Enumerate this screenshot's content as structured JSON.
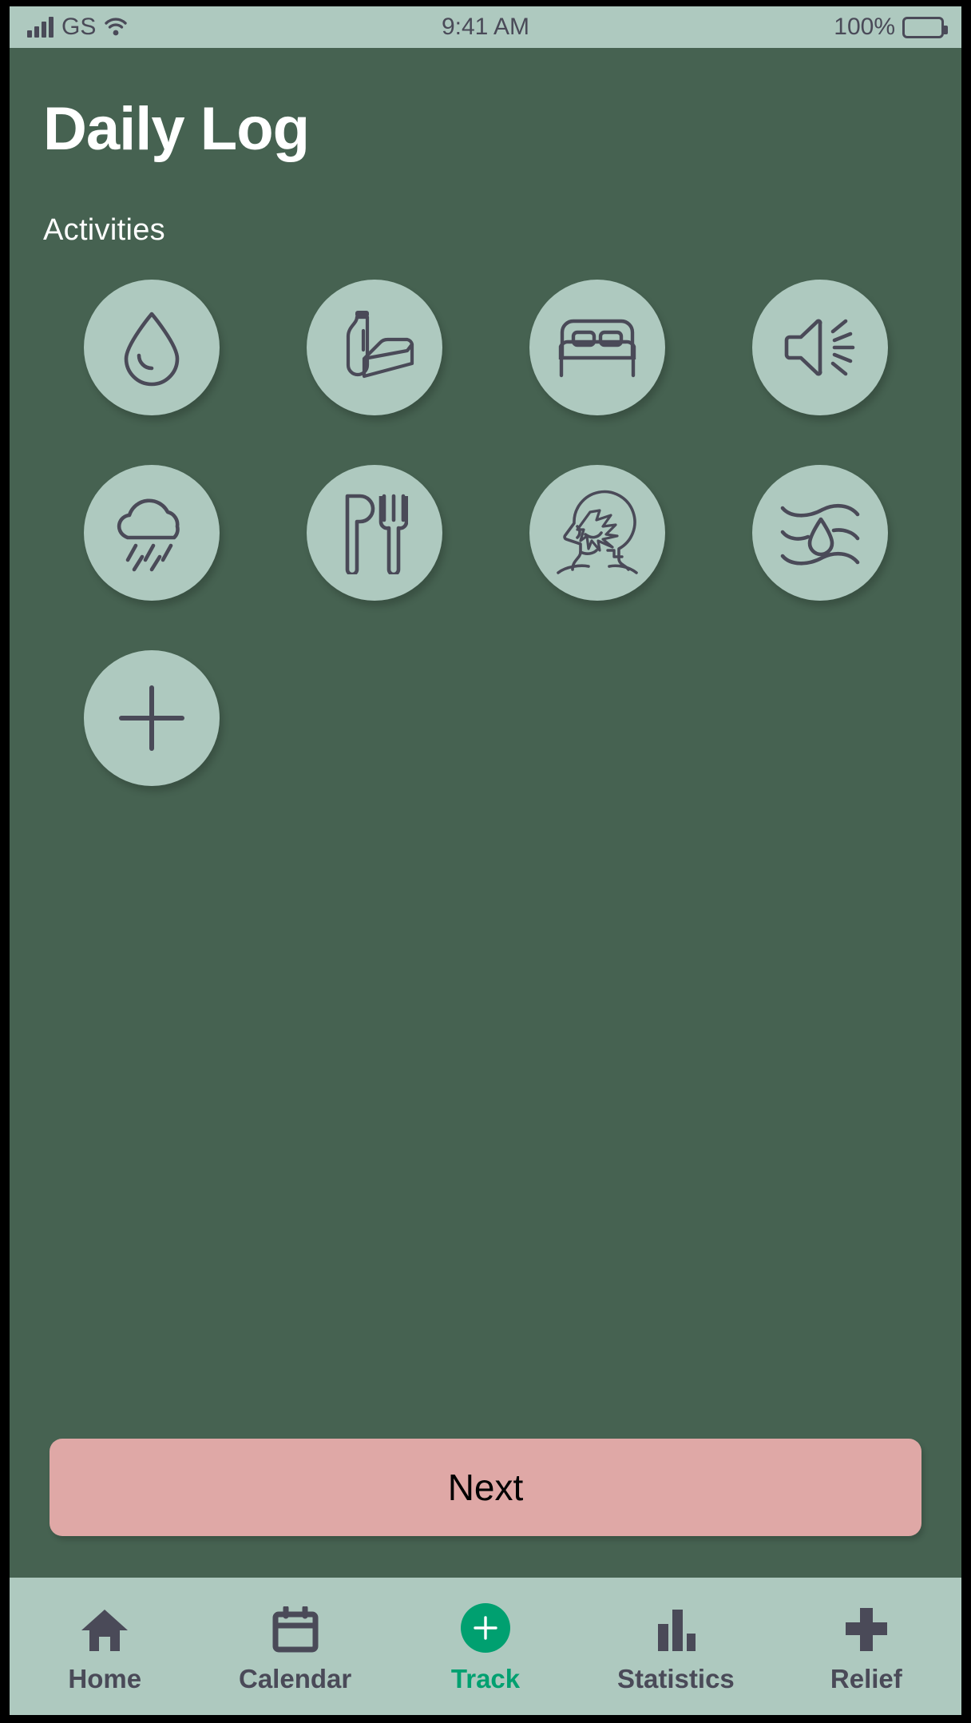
{
  "status_bar": {
    "carrier": "GS",
    "time": "9:41 AM",
    "battery_percent": "100%",
    "signal_icon": "signal-bars-icon",
    "wifi_icon": "wifi-icon",
    "battery_icon": "battery-full-icon"
  },
  "header": {
    "title": "Daily Log"
  },
  "main": {
    "section_label": "Activities",
    "activities": [
      {
        "name": "water",
        "icon": "water-drop-icon"
      },
      {
        "name": "dairy",
        "icon": "milk-bottle-cheese-icon"
      },
      {
        "name": "sleep",
        "icon": "bed-icon"
      },
      {
        "name": "noise",
        "icon": "loud-speaker-icon"
      },
      {
        "name": "weather",
        "icon": "rain-cloud-icon"
      },
      {
        "name": "food",
        "icon": "knife-fork-icon"
      },
      {
        "name": "stress",
        "icon": "head-stress-icon"
      },
      {
        "name": "humidity",
        "icon": "humidity-waves-icon"
      },
      {
        "name": "add",
        "icon": "plus-icon"
      }
    ],
    "next_label": "Next"
  },
  "tabbar": {
    "items": [
      {
        "label": "Home",
        "icon": "home-icon",
        "active": false
      },
      {
        "label": "Calendar",
        "icon": "calendar-icon",
        "active": false
      },
      {
        "label": "Track",
        "icon": "plus-circle-icon",
        "active": true
      },
      {
        "label": "Statistics",
        "icon": "bar-chart-icon",
        "active": false
      },
      {
        "label": "Relief",
        "icon": "medical-cross-icon",
        "active": false
      }
    ]
  },
  "colors": {
    "background": "#466251",
    "chip": "#aec9bf",
    "icon_stroke": "#4a4a58",
    "accent_pink": "#dfa8a6",
    "accent_green": "#00a070",
    "title": "#ffffff"
  }
}
